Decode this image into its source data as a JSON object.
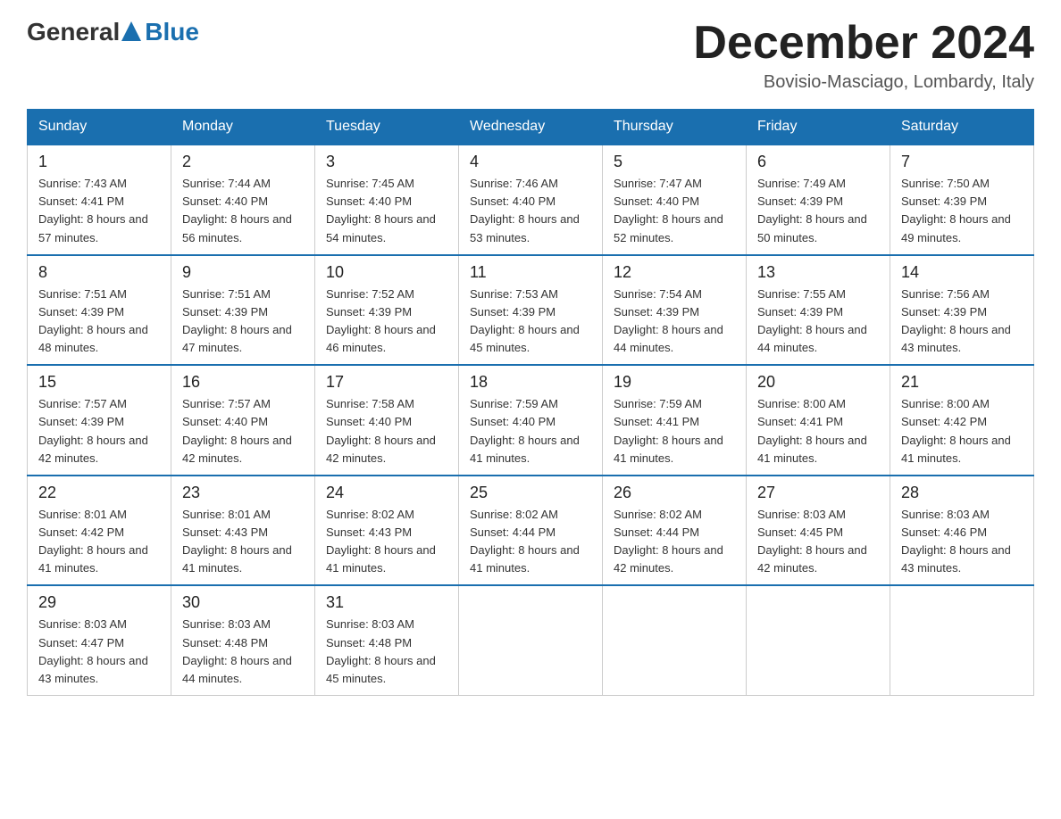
{
  "header": {
    "logo_general": "General",
    "logo_blue": "Blue",
    "month_title": "December 2024",
    "location": "Bovisio-Masciago, Lombardy, Italy"
  },
  "days_of_week": [
    "Sunday",
    "Monday",
    "Tuesday",
    "Wednesday",
    "Thursday",
    "Friday",
    "Saturday"
  ],
  "weeks": [
    [
      {
        "day": "1",
        "sunrise": "7:43 AM",
        "sunset": "4:41 PM",
        "daylight": "8 hours and 57 minutes."
      },
      {
        "day": "2",
        "sunrise": "7:44 AM",
        "sunset": "4:40 PM",
        "daylight": "8 hours and 56 minutes."
      },
      {
        "day": "3",
        "sunrise": "7:45 AM",
        "sunset": "4:40 PM",
        "daylight": "8 hours and 54 minutes."
      },
      {
        "day": "4",
        "sunrise": "7:46 AM",
        "sunset": "4:40 PM",
        "daylight": "8 hours and 53 minutes."
      },
      {
        "day": "5",
        "sunrise": "7:47 AM",
        "sunset": "4:40 PM",
        "daylight": "8 hours and 52 minutes."
      },
      {
        "day": "6",
        "sunrise": "7:49 AM",
        "sunset": "4:39 PM",
        "daylight": "8 hours and 50 minutes."
      },
      {
        "day": "7",
        "sunrise": "7:50 AM",
        "sunset": "4:39 PM",
        "daylight": "8 hours and 49 minutes."
      }
    ],
    [
      {
        "day": "8",
        "sunrise": "7:51 AM",
        "sunset": "4:39 PM",
        "daylight": "8 hours and 48 minutes."
      },
      {
        "day": "9",
        "sunrise": "7:51 AM",
        "sunset": "4:39 PM",
        "daylight": "8 hours and 47 minutes."
      },
      {
        "day": "10",
        "sunrise": "7:52 AM",
        "sunset": "4:39 PM",
        "daylight": "8 hours and 46 minutes."
      },
      {
        "day": "11",
        "sunrise": "7:53 AM",
        "sunset": "4:39 PM",
        "daylight": "8 hours and 45 minutes."
      },
      {
        "day": "12",
        "sunrise": "7:54 AM",
        "sunset": "4:39 PM",
        "daylight": "8 hours and 44 minutes."
      },
      {
        "day": "13",
        "sunrise": "7:55 AM",
        "sunset": "4:39 PM",
        "daylight": "8 hours and 44 minutes."
      },
      {
        "day": "14",
        "sunrise": "7:56 AM",
        "sunset": "4:39 PM",
        "daylight": "8 hours and 43 minutes."
      }
    ],
    [
      {
        "day": "15",
        "sunrise": "7:57 AM",
        "sunset": "4:39 PM",
        "daylight": "8 hours and 42 minutes."
      },
      {
        "day": "16",
        "sunrise": "7:57 AM",
        "sunset": "4:40 PM",
        "daylight": "8 hours and 42 minutes."
      },
      {
        "day": "17",
        "sunrise": "7:58 AM",
        "sunset": "4:40 PM",
        "daylight": "8 hours and 42 minutes."
      },
      {
        "day": "18",
        "sunrise": "7:59 AM",
        "sunset": "4:40 PM",
        "daylight": "8 hours and 41 minutes."
      },
      {
        "day": "19",
        "sunrise": "7:59 AM",
        "sunset": "4:41 PM",
        "daylight": "8 hours and 41 minutes."
      },
      {
        "day": "20",
        "sunrise": "8:00 AM",
        "sunset": "4:41 PM",
        "daylight": "8 hours and 41 minutes."
      },
      {
        "day": "21",
        "sunrise": "8:00 AM",
        "sunset": "4:42 PM",
        "daylight": "8 hours and 41 minutes."
      }
    ],
    [
      {
        "day": "22",
        "sunrise": "8:01 AM",
        "sunset": "4:42 PM",
        "daylight": "8 hours and 41 minutes."
      },
      {
        "day": "23",
        "sunrise": "8:01 AM",
        "sunset": "4:43 PM",
        "daylight": "8 hours and 41 minutes."
      },
      {
        "day": "24",
        "sunrise": "8:02 AM",
        "sunset": "4:43 PM",
        "daylight": "8 hours and 41 minutes."
      },
      {
        "day": "25",
        "sunrise": "8:02 AM",
        "sunset": "4:44 PM",
        "daylight": "8 hours and 41 minutes."
      },
      {
        "day": "26",
        "sunrise": "8:02 AM",
        "sunset": "4:44 PM",
        "daylight": "8 hours and 42 minutes."
      },
      {
        "day": "27",
        "sunrise": "8:03 AM",
        "sunset": "4:45 PM",
        "daylight": "8 hours and 42 minutes."
      },
      {
        "day": "28",
        "sunrise": "8:03 AM",
        "sunset": "4:46 PM",
        "daylight": "8 hours and 43 minutes."
      }
    ],
    [
      {
        "day": "29",
        "sunrise": "8:03 AM",
        "sunset": "4:47 PM",
        "daylight": "8 hours and 43 minutes."
      },
      {
        "day": "30",
        "sunrise": "8:03 AM",
        "sunset": "4:48 PM",
        "daylight": "8 hours and 44 minutes."
      },
      {
        "day": "31",
        "sunrise": "8:03 AM",
        "sunset": "4:48 PM",
        "daylight": "8 hours and 45 minutes."
      },
      null,
      null,
      null,
      null
    ]
  ],
  "labels": {
    "sunrise_prefix": "Sunrise: ",
    "sunset_prefix": "Sunset: ",
    "daylight_prefix": "Daylight: "
  }
}
